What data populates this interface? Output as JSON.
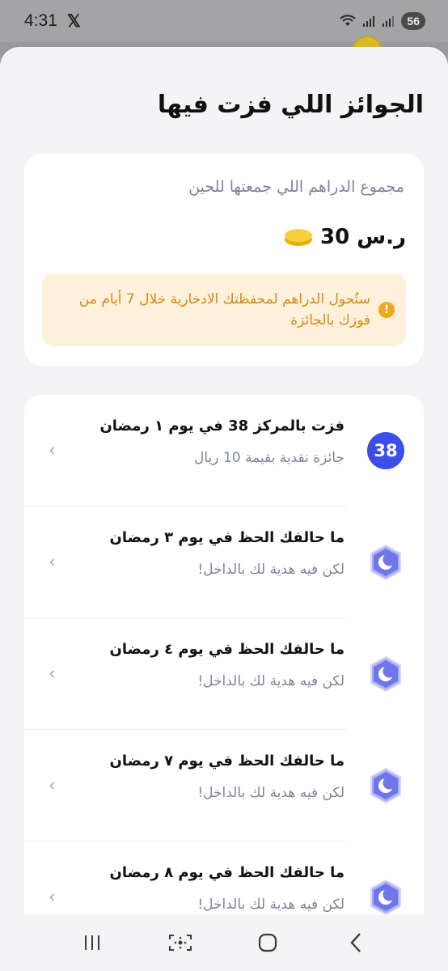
{
  "status_bar": {
    "time": "4:31",
    "x_logo": "𝕏",
    "battery": "56"
  },
  "sheet": {
    "title": "الجوائز اللي فزت فيها"
  },
  "summary": {
    "label": "مجموع الدراهم اللي جمعتها للحين",
    "amount": "30 ر.س",
    "notice_icon": "!",
    "notice": "ستُحول الدراهم لمحفظتك الادخارية خلال 7 أيام من فوزك بالجائزة"
  },
  "prizes": [
    {
      "badge_type": "number",
      "badge": "38",
      "title": "فزت بالمركز 38 في يوم ١ رمضان",
      "subtitle": "جائزة نقدية بقيمة 10 ريال",
      "chevron": "‹"
    },
    {
      "badge_type": "moon",
      "title": "ما حالفك الحظ في يوم ٣ رمضان",
      "subtitle": "لكن فيه هدية لك بالداخل!",
      "chevron": "‹"
    },
    {
      "badge_type": "moon",
      "title": "ما حالفك الحظ في يوم ٤ رمضان",
      "subtitle": "لكن فيه هدية لك بالداخل!",
      "chevron": "‹"
    },
    {
      "badge_type": "moon",
      "title": "ما حالفك الحظ في يوم ٧ رمضان",
      "subtitle": "لكن فيه هدية لك بالداخل!",
      "chevron": "‹"
    },
    {
      "badge_type": "moon",
      "title": "ما حالفك الحظ في يوم ٨ رمضان",
      "subtitle": "لكن فيه هدية لك بالداخل!",
      "chevron": "‹"
    }
  ],
  "icons": {
    "wifi": "wifi-icon",
    "signal": "signal-icon",
    "moon_badge": "crescent-moon-hexagon-icon",
    "coin": "coin-stack-icon",
    "nav_recents": "recents-icon",
    "nav_scan": "scan-icon",
    "nav_home": "home-icon",
    "nav_back": "back-icon"
  },
  "colors": {
    "accent_blue": "#3d4ee8",
    "moon_badge": "#6f76ea",
    "notice_bg": "#fdf1dc",
    "notice_text": "#d48a12",
    "coin": "#f7d13a"
  }
}
